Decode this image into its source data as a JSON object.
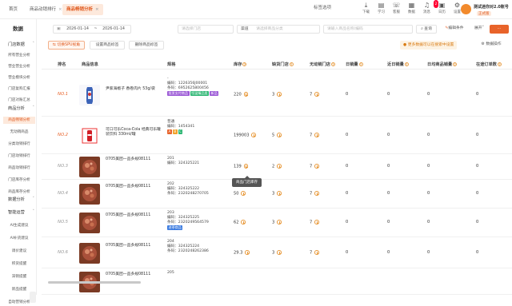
{
  "topbar": {
    "tabs": [
      {
        "label": "首页"
      },
      {
        "label": "商品动销排行"
      },
      {
        "label": "商品畅销分析"
      }
    ],
    "center_title": "标签选项",
    "icons": [
      {
        "name": "download-icon",
        "label": "下载"
      },
      {
        "name": "study-icon",
        "label": "学习"
      },
      {
        "name": "feedback-icon",
        "label": "客服"
      },
      {
        "name": "stats-icon",
        "label": "数据"
      },
      {
        "name": "notify-icon",
        "label": "消息",
        "badge": "2"
      },
      {
        "name": "calendar-icon",
        "label": "日历"
      },
      {
        "name": "settings-icon",
        "label": "设置"
      }
    ],
    "user": {
      "name": "测试迷你对2.0账号",
      "role": "正式版"
    }
  },
  "sidebar": {
    "title": "数据",
    "groups": [
      {
        "label": "门店数据",
        "items": [
          "所有营业分析",
          "营业营业分析",
          "营业模块分析",
          "门店复购汇报",
          "门店对账汇总"
        ]
      },
      {
        "label": "商品分析",
        "items": [
          "商品畅销分析",
          "无动销商品",
          "分类动销排行",
          "门店动销排行",
          "商品动销排行",
          "门店库存分析",
          "商品库存分析"
        ]
      },
      {
        "label": "数据分析",
        "items": []
      },
      {
        "label": "智能运营",
        "items": [
          "AI生成建议",
          "AI补货建议",
          "调价建议",
          "积货提醒",
          "滞销提醒",
          "新品提醒",
          "自动营销分析"
        ]
      }
    ]
  },
  "filters": {
    "date_start": "2026-01-14",
    "date_sep": "~",
    "date_end": "2026-01-14",
    "store_placeholder": "请选择门店",
    "supplier_label": "渠道",
    "supplier_placeholder": "请选择商品分类",
    "search_placeholder": "请输入商品名称/编码",
    "query_label": "查询",
    "edit_label": "编辑条件",
    "expand_label": "展开",
    "switch_label": "切换SPU视角",
    "set_label": "设置商品标签",
    "delete_label": "删除商品标签",
    "notice": "更多数据可以在搜索中设置",
    "export_label": "数据操作"
  },
  "table": {
    "columns": [
      "排名",
      "商品信息",
      "规格",
      "库存",
      "缺货门店",
      "无动销门店",
      "日销量",
      "近日销量",
      "日均商品销量",
      "在途订单数"
    ],
    "rows": [
      {
        "no": "NO.1",
        "name": "尹家海椒子 香卷肉片 53g/袋",
        "spec_main": "-",
        "code_label": "编码：",
        "code": "1226356J00001",
        "barcode_label": "条码：",
        "barcode": "6952625800456",
        "tags": [
          {
            "text": "批发支付商品",
            "color": "#9b59d6"
          },
          {
            "text": "恒温臻品类",
            "color": "#2db673"
          },
          {
            "text": "新品",
            "color": "#9b59d6"
          }
        ],
        "stock": "220",
        "out_stores": "3",
        "nomove_stores": "7",
        "daily": "0",
        "recent": "0",
        "avg": "0",
        "transit": "0",
        "img": "tin"
      },
      {
        "no": "NO.2",
        "name": "可口可乐Coca-Cola 经典可乐罐装饮料 330ml/罐",
        "spec_main": "普通",
        "code_label": "编码：",
        "code": "1454341",
        "barcode_label": "",
        "barcode": "",
        "tags": [
          {
            "text": "A",
            "color": "#e8632a"
          },
          {
            "text": "B",
            "color": "#f1a22b"
          },
          {
            "text": "C",
            "color": "#2db673"
          }
        ],
        "stock": "199003",
        "out_stores": "5",
        "nomove_stores": "7",
        "daily": "0",
        "recent": "0",
        "avg": "0",
        "transit": "0",
        "img": "cola"
      },
      {
        "no": "NO.3",
        "name": "0705美团一品多规08111",
        "spec_main": "201",
        "code_label": "编码：",
        "code": "324325221",
        "barcode_label": "",
        "barcode": "",
        "tags": [],
        "stock": "139",
        "out_stores": "2",
        "nomove_stores": "7",
        "daily": "0",
        "recent": "0",
        "avg": "0",
        "transit": "0",
        "img": "meat"
      },
      {
        "no": "NO.4",
        "name": "0705美团一品多规08111",
        "spec_main": "202",
        "code_label": "编码：",
        "code": "324325222",
        "barcode_label": "条码：",
        "barcode": "2320248270705",
        "tags": [],
        "stock": "50",
        "out_stores": "3",
        "nomove_stores": "7",
        "daily": "0",
        "recent": "0",
        "avg": "0",
        "transit": "0",
        "img": "meat"
      },
      {
        "no": "NO.5",
        "name": "0705美团一品多规08111",
        "spec_main": "203",
        "code_label": "编码：",
        "code": "324325225",
        "barcode_label": "条码：",
        "barcode": "2320249564579",
        "tags": [
          {
            "text": "进季商品",
            "color": "#3b7be0"
          }
        ],
        "stock": "62",
        "out_stores": "3",
        "nomove_stores": "7",
        "daily": "0",
        "recent": "0",
        "avg": "0",
        "transit": "0",
        "img": "meat"
      },
      {
        "no": "NO.6",
        "name": "0705美团一品多规08111",
        "spec_main": "204",
        "code_label": "编码：",
        "code": "324325224",
        "barcode_label": "条码：",
        "barcode": "2320248262386",
        "tags": [],
        "stock": "29.3",
        "out_stores": "3",
        "nomove_stores": "7",
        "daily": "0",
        "recent": "0",
        "avg": "0",
        "transit": "0",
        "img": "meat"
      },
      {
        "no": "",
        "name": "0705美团一品多规08111",
        "spec_main": "205",
        "code_label": "",
        "code": "",
        "barcode_label": "",
        "barcode": "",
        "tags": [],
        "stock": "",
        "out_stores": "",
        "nomove_stores": "",
        "daily": "",
        "recent": "",
        "avg": "",
        "transit": "",
        "img": "meat"
      }
    ]
  },
  "tooltip": "商品门店库存",
  "colors": {
    "accent": "#e8632a",
    "accent_light": "#fde9dc"
  }
}
